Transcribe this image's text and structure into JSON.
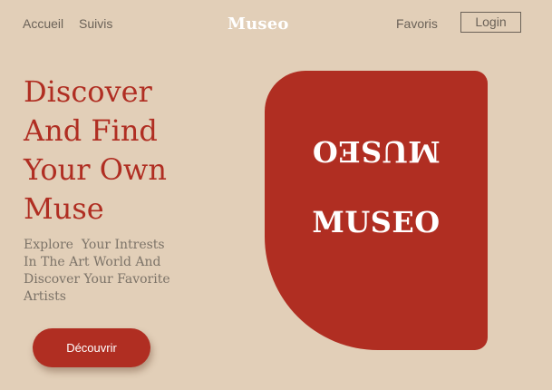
{
  "nav": {
    "left_links": [
      "Accueil",
      "Suivis"
    ],
    "brand": "Museo",
    "right_link": "Favoris",
    "login_label": "Login"
  },
  "hero": {
    "title_lines": [
      "Discover",
      "And Find",
      "Your Own",
      "Muse"
    ],
    "subtitle_lines": [
      "Explore  Your Intrests",
      "In The Art World And",
      "Discover Your Favorite",
      "Artists"
    ],
    "cta_label": "Découvrir"
  },
  "card": {
    "text_flipped": "MUSEO",
    "text_upright": "MUSEO"
  },
  "colors": {
    "background": "#e2cfb8",
    "accent": "#b02e22",
    "nav_text": "#6b6258",
    "body_text": "#7c7368"
  }
}
